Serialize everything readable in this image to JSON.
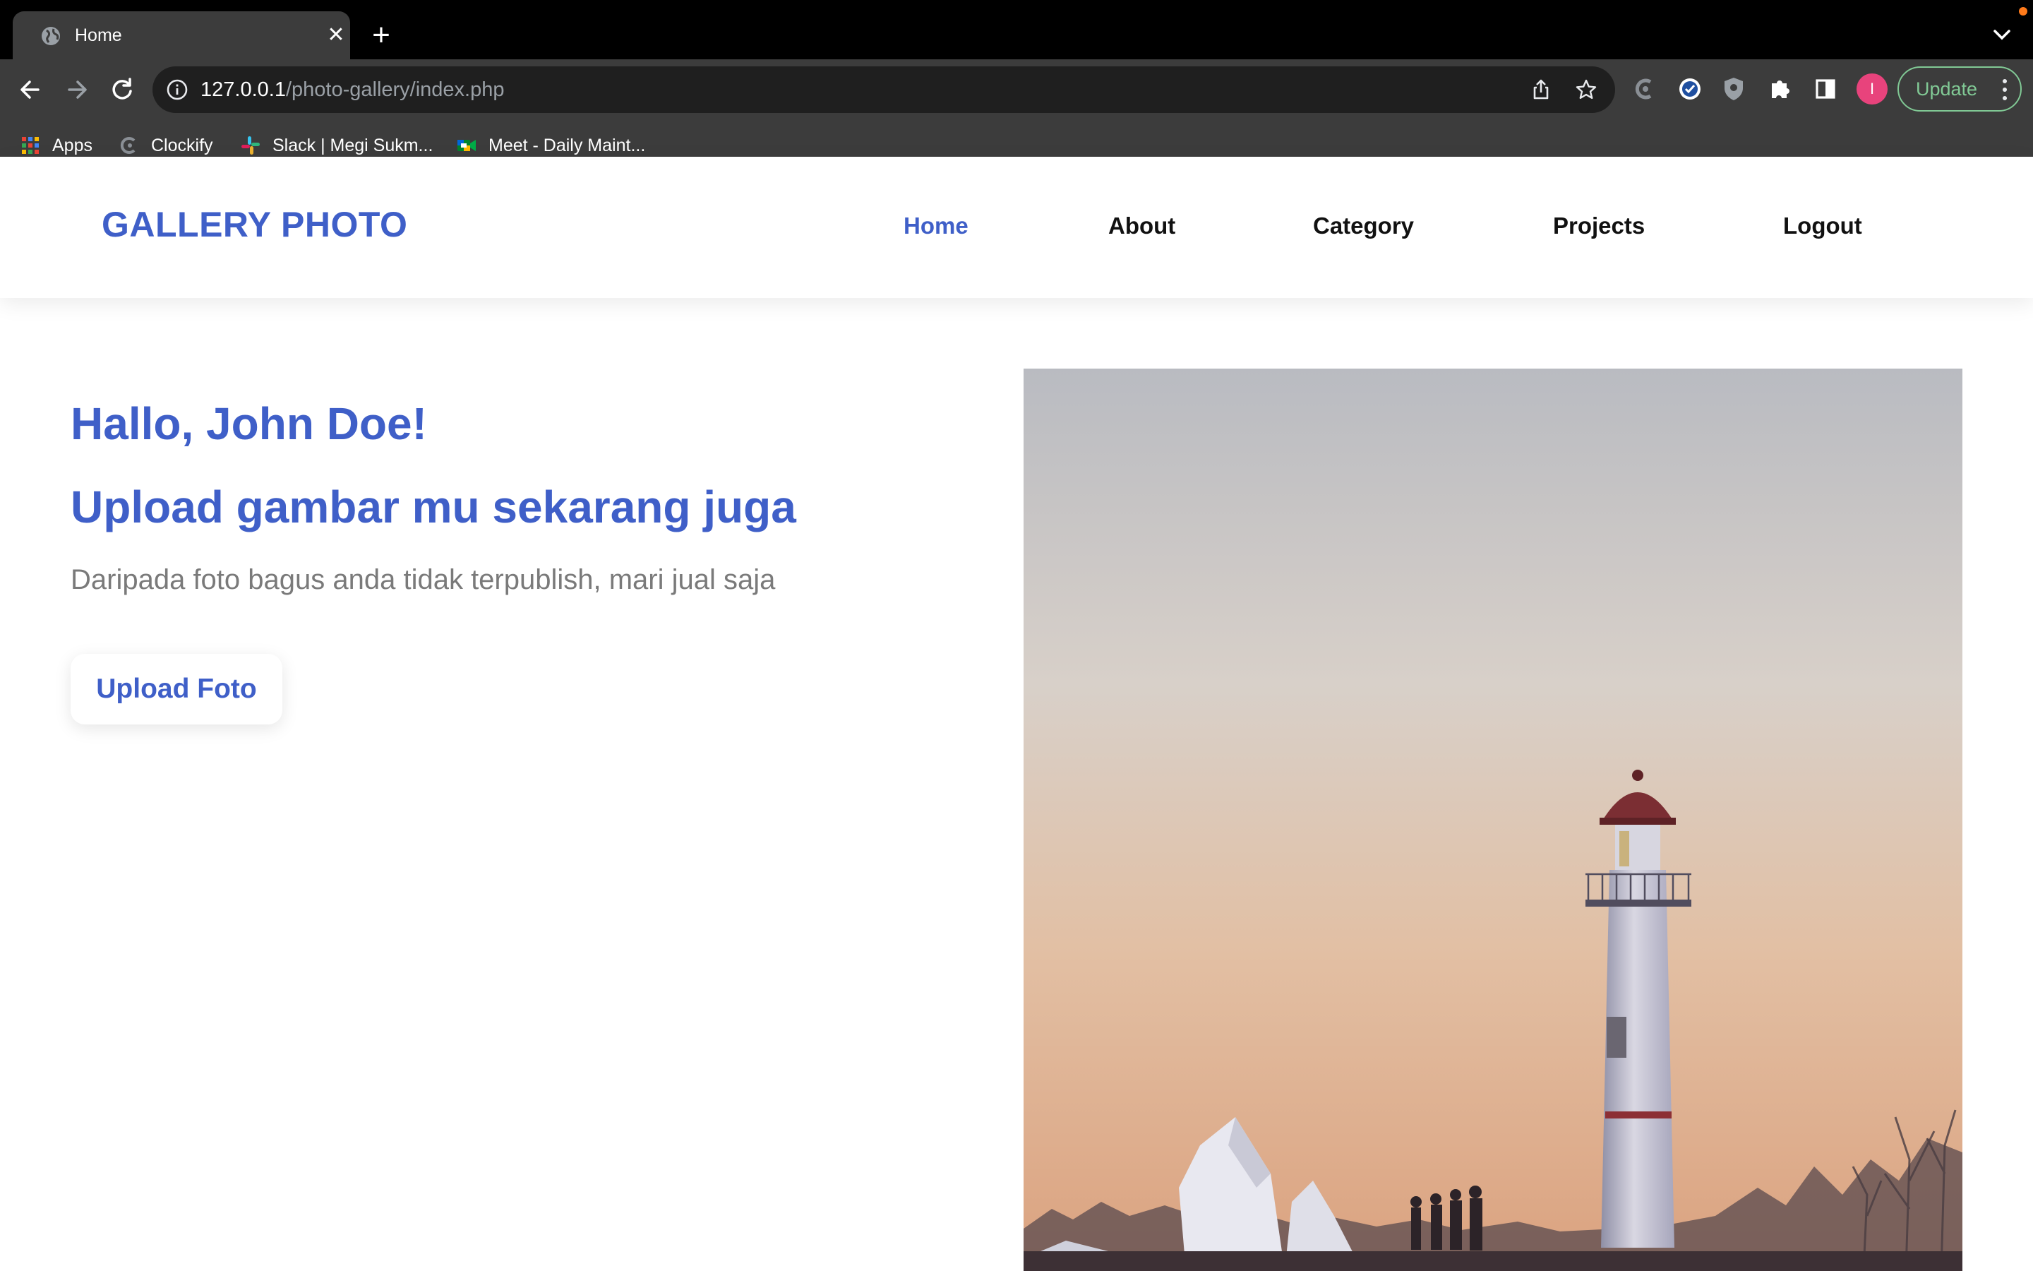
{
  "browser": {
    "tab": {
      "title": "Home",
      "close_glyph": "✕"
    },
    "new_tab_glyph": "+",
    "address": {
      "host": "127.0.0.1",
      "path": "/photo-gallery/index.php"
    },
    "profile_initial": "I",
    "update_label": "Update",
    "bookmarks": [
      {
        "label": "Apps",
        "icon": "apps-grid-icon"
      },
      {
        "label": "Clockify",
        "icon": "clockify-icon"
      },
      {
        "label": "Slack | Megi Sukm...",
        "icon": "slack-icon"
      },
      {
        "label": "Meet - Daily Maint...",
        "icon": "google-meet-icon"
      }
    ],
    "colors": {
      "tabbar": "#000000",
      "toolbar": "#3c3c3c",
      "omnibox": "#1f1f1f",
      "update": "#81c995",
      "avatar": "#e8437c"
    }
  },
  "site": {
    "brand": "GALLERY PHOTO",
    "nav": [
      {
        "label": "Home",
        "active": true
      },
      {
        "label": "About",
        "active": false
      },
      {
        "label": "Category",
        "active": false
      },
      {
        "label": "Projects",
        "active": false
      },
      {
        "label": "Logout",
        "active": false
      }
    ],
    "accent_color": "#3f5fc8"
  },
  "hero": {
    "greeting": "Hallo, John Doe!",
    "headline": "Upload gambar mu sekarang juga",
    "subtitle": "Daripada foto bagus anda tidak terpublish, mari jual saja",
    "cta_label": "Upload Foto",
    "image_subject": "lighthouse at sunset"
  }
}
